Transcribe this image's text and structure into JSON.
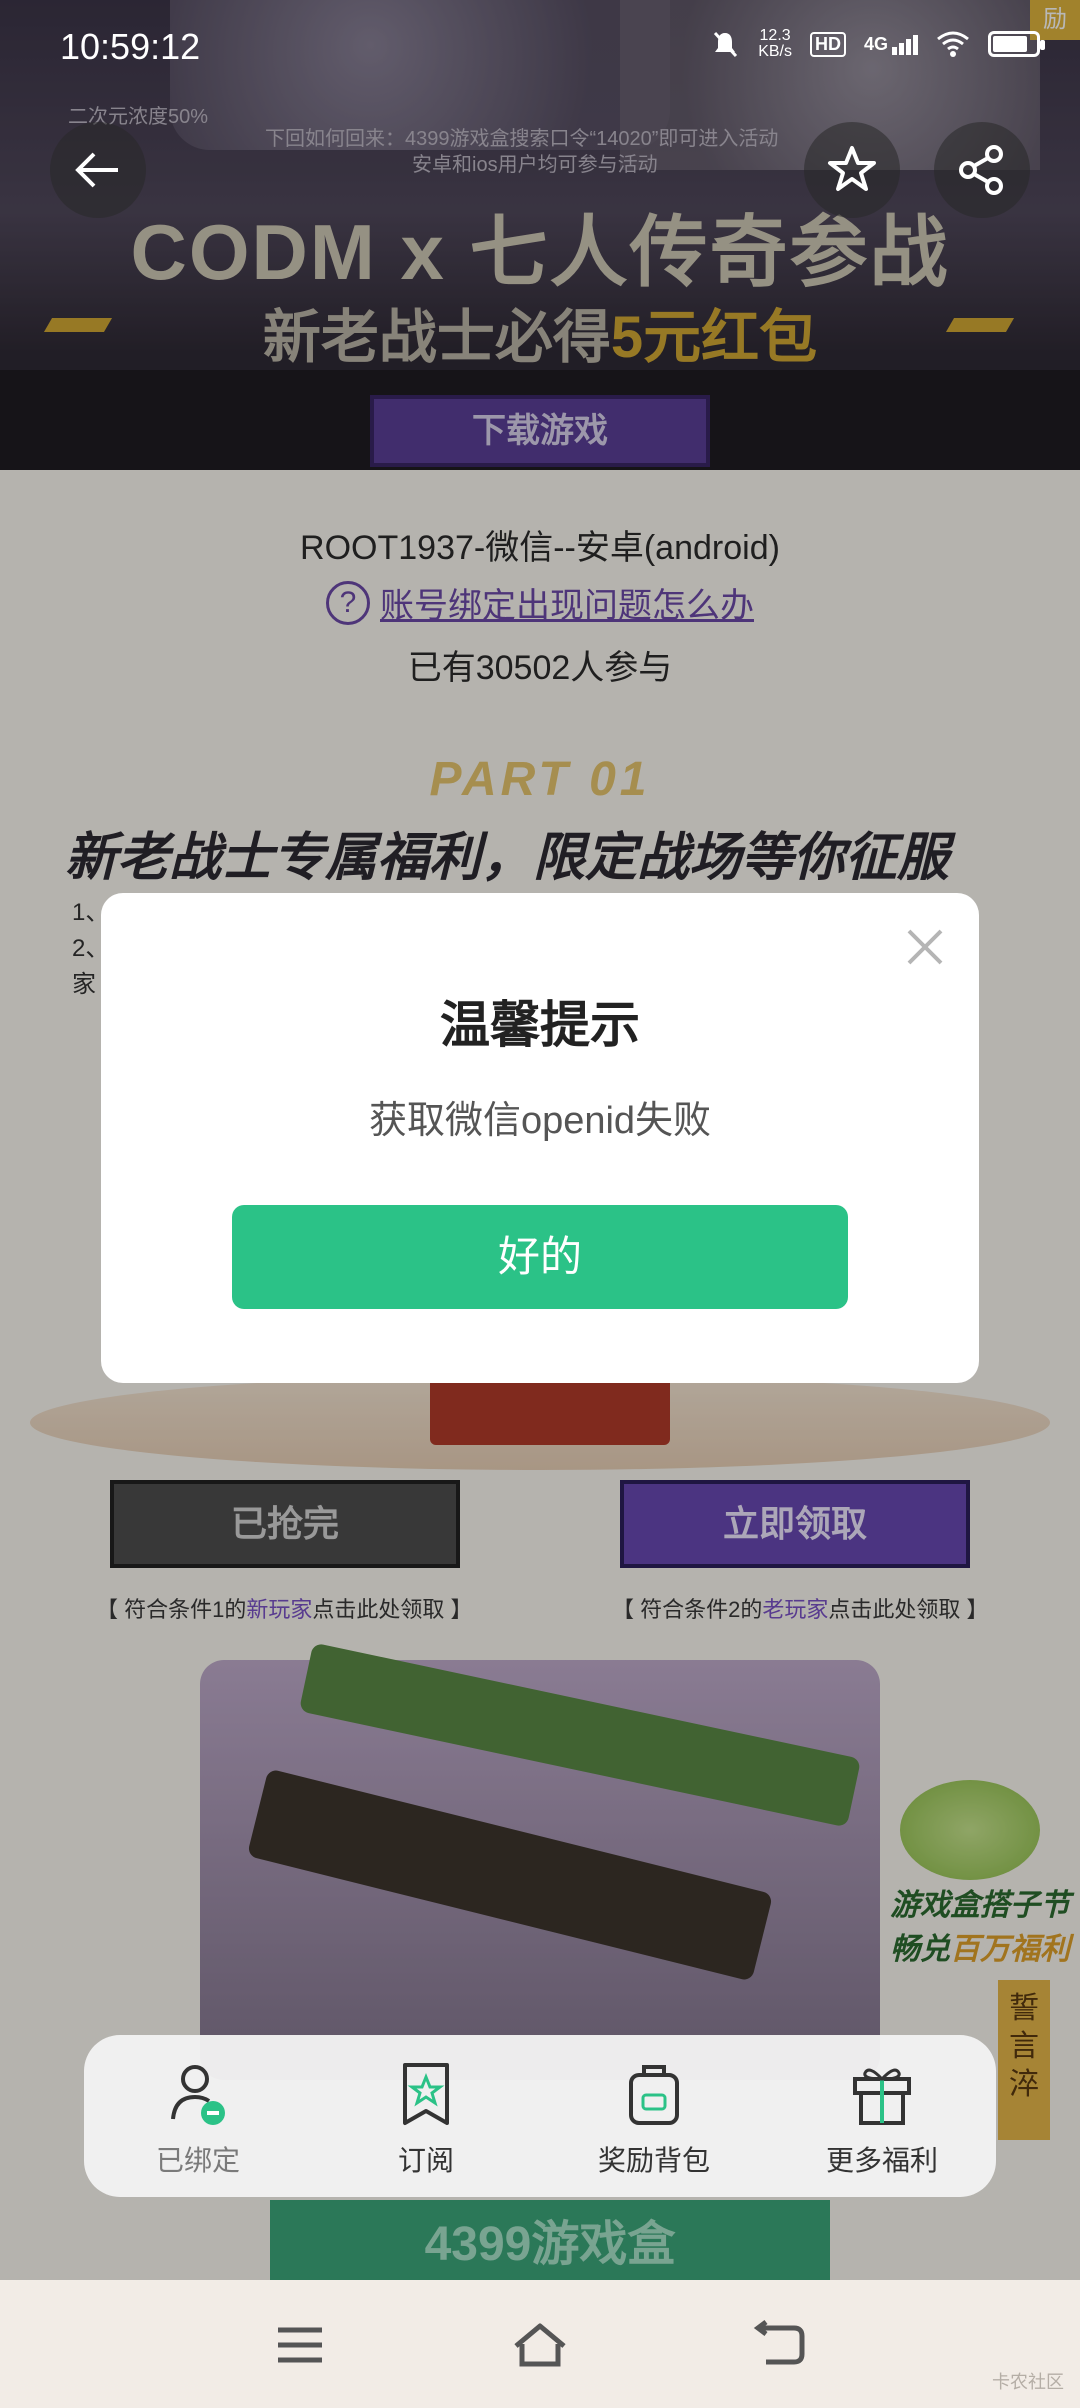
{
  "status_bar": {
    "time": "10:59:12",
    "net_speed_value": "12.3",
    "net_speed_unit": "KB/s",
    "hd_label": "HD",
    "network_label": "4G",
    "battery_level": 0.8
  },
  "banner": {
    "corner_badge": "励",
    "tag_line": "二次元浓度50%",
    "notice_line1": "下回如何回来：4399游戏盒搜索口令“14020”即可进入活动",
    "notice_line2": "安卓和ios用户均可参与活动",
    "title": "CODM x 七人传奇参战",
    "subtitle_prefix": "新老战士必得",
    "subtitle_highlight": "5元红包",
    "download_label": "下载游戏"
  },
  "account": {
    "info": "ROOT1937-微信--安卓(android)",
    "help_icon": "question-circle-icon",
    "help_link": "账号绑定出现问题怎么办",
    "participants": "已有30502人参与"
  },
  "section": {
    "part_label": "PART 01",
    "title": "新老战士专属福利，限定战场等你征服",
    "rule1": "1、",
    "rule2": "2、",
    "rule3": "家"
  },
  "claims": {
    "claimed_label": "已抢完",
    "claim_now_label": "立即领取",
    "note1_prefix": "【 符合条件1的",
    "note1_highlight": "新玩家",
    "note1_suffix": "点击此处领取 】",
    "note2_prefix": "【 符合条件2的",
    "note2_highlight": "老玩家",
    "note2_suffix": "点击此处领取 】"
  },
  "promo": {
    "line1": "游戏盒搭子节",
    "line2_prefix": "畅兑",
    "line2_highlight": "百万福利",
    "side_tag": "誓言淬",
    "footer": "4399游戏盒"
  },
  "modal": {
    "title": "温馨提示",
    "message": "获取微信openid失败",
    "ok_label": "好的",
    "close_icon": "close-icon"
  },
  "tabbar": {
    "items": [
      {
        "label": "已绑定",
        "icon": "user-bound-icon"
      },
      {
        "label": "订阅",
        "icon": "bookmark-star-icon"
      },
      {
        "label": "奖励背包",
        "icon": "backpack-icon"
      },
      {
        "label": "更多福利",
        "icon": "gift-icon"
      }
    ]
  },
  "navbar": {
    "menu_icon": "menu-icon",
    "home_icon": "home-icon",
    "back_icon": "back-icon",
    "watermark": "卡农社区"
  },
  "colors": {
    "accent_green": "#2bc287",
    "link_purple": "#6c4aa8",
    "claim_purple": "#6948b3"
  }
}
